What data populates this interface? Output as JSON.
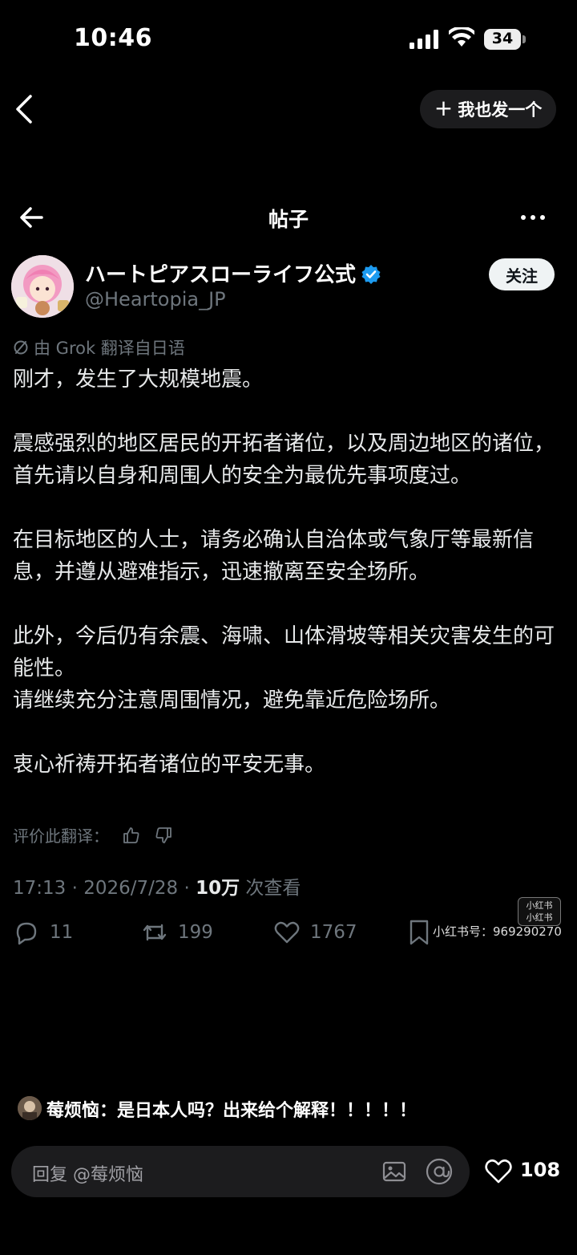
{
  "status_bar": {
    "time": "10:46",
    "battery": "34"
  },
  "top_nav": {
    "post_too_label": "我也发一个"
  },
  "x_header": {
    "title": "帖子"
  },
  "post": {
    "author_name": "ハートピアスローライフ公式",
    "handle": "@Heartopia_JP",
    "follow_label": "关注",
    "translated_note": "由 Grok 翻译自日语",
    "paragraphs": [
      "刚才，发生了大规模地震。",
      "震感强烈的地区居民的开拓者诸位，以及周边地区的诸位，首先请以自身和周围人的安全为最优先事项度过。",
      "在目标地区的人士，请务必确认自治体或气象厅等最新信息，并遵从避难指示，迅速撤离至安全场所。",
      "此外，今后仍有余震、海啸、山体滑坡等相关灾害发生的可能性。\n请继续充分注意周围情况，避免靠近危险场所。",
      "衷心祈祷开拓者诸位的平安无事。"
    ],
    "rate_translation": "评价此翻译：",
    "timestamp": "17:13 · 2026/7/28 · ",
    "views_count": "10万",
    "views_label": " 次查看",
    "replies": "11",
    "reposts": "199",
    "likes": "1767"
  },
  "watermark": {
    "text": "小红书号：969290270",
    "logo_top": "小红书",
    "logo_bottom": "小红书"
  },
  "comment": {
    "author": "莓烦恼",
    "text": "莓烦恼：是日本人吗？出来给个解释！！！！！"
  },
  "reply_bar": {
    "placeholder": "回复 @莓烦恼",
    "like_count": "108"
  },
  "colors": {
    "background": "#000000",
    "text": "#e7e9ea",
    "muted": "#6e767d",
    "verified": "#1d9bf0"
  }
}
